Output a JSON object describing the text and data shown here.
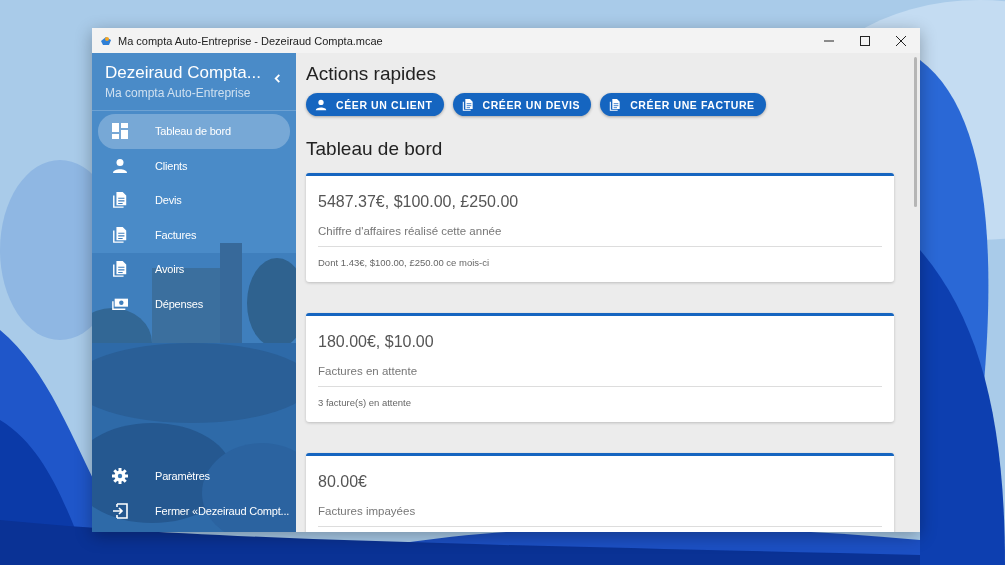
{
  "window": {
    "title": "Ma compta Auto-Entreprise - Dezeiraud Compta.mcae"
  },
  "sidebar": {
    "title": "Dezeiraud Compta...",
    "subtitle": "Ma compta Auto-Entreprise",
    "items": [
      {
        "label": "Tableau de bord",
        "kind": "dashboard",
        "selected": true
      },
      {
        "label": "Clients",
        "kind": "person",
        "selected": false
      },
      {
        "label": "Devis",
        "kind": "document",
        "selected": false
      },
      {
        "label": "Factures",
        "kind": "document",
        "selected": false
      },
      {
        "label": "Avoirs",
        "kind": "document",
        "selected": false
      },
      {
        "label": "Dépenses",
        "kind": "money",
        "selected": false
      }
    ],
    "footer_items": [
      {
        "label": "Paramètres",
        "kind": "gear"
      },
      {
        "label": "Fermer «Dezeiraud Compt...",
        "kind": "exit"
      }
    ]
  },
  "quick_actions": {
    "title": "Actions rapides",
    "buttons": [
      {
        "label": "CÉER UN CLIENT",
        "kind": "person"
      },
      {
        "label": "CRÉER UN DEVIS",
        "kind": "document"
      },
      {
        "label": "CRÉER UNE FACTURE",
        "kind": "document"
      }
    ]
  },
  "dashboard": {
    "title": "Tableau de bord",
    "cards": [
      {
        "amount": "5487.37€, $100.00, £250.00",
        "label": "Chiffre d'affaires réalisé cette année",
        "detail": "Dont 1.43€, $100.00, £250.00 ce mois-ci"
      },
      {
        "amount": "180.00€, $10.00",
        "label": "Factures en attente",
        "detail": "3 facture(s) en attente"
      },
      {
        "amount": "80.00€",
        "label": "Factures impayées"
      }
    ]
  }
}
